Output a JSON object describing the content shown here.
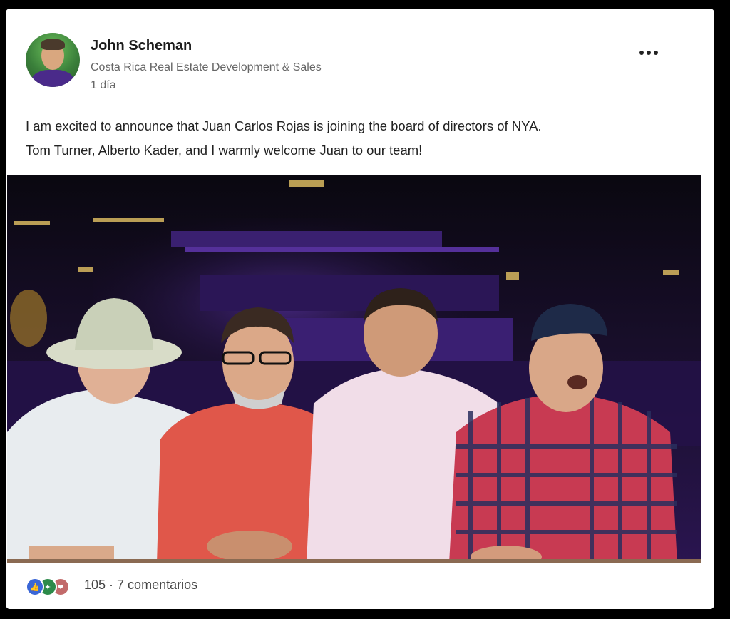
{
  "post": {
    "author": {
      "name": "John Scheman",
      "headline": "Costa Rica Real Estate Development & Sales",
      "time": "1 día",
      "avatar_icon": "profile-photo"
    },
    "more_icon": "ellipsis-icon",
    "text_lines": [
      "I am excited to announce that Juan Carlos Rojas is joining the board of directors of NYA.",
      "Tom Turner, Alberto Kader, and I warmly welcome Juan to our team!"
    ],
    "image": {
      "subject": "photo-of-four-men-at-night"
    },
    "social": {
      "reaction_icons": [
        "like-icon",
        "celebrate-icon",
        "love-icon"
      ],
      "reactions_count": "105",
      "separator": " · ",
      "comments": "7 comentarios"
    }
  },
  "colors": {
    "background": "#000000",
    "card": "#ffffff",
    "text": "#222222",
    "muted": "#666666",
    "like": "#3a66d6",
    "celebrate": "#2c8a4a",
    "love": "#c26a6a"
  }
}
